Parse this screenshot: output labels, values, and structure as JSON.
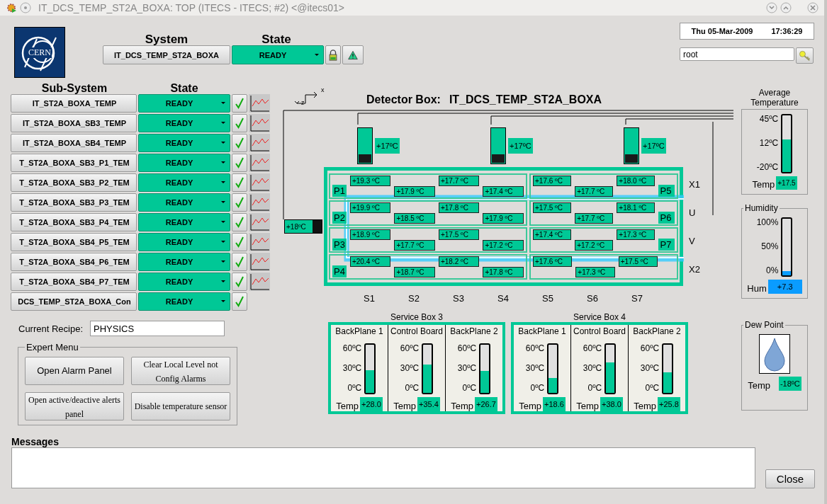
{
  "window": {
    "title": "IT_DCS_TEMP_ST2A_BOXA: TOP (ITECS - ITECS; #2) <@itecs01>"
  },
  "logo": {
    "text": "CERN"
  },
  "system": {
    "system_header": "System",
    "state_header": "State",
    "name": "IT_DCS_TEMP_ST2A_BOXA",
    "state": "READY"
  },
  "clock": {
    "date": "Thu 05-Mar-2009",
    "time": "17:36:29"
  },
  "user": {
    "value": "root"
  },
  "subsystems": {
    "name_header": "Sub-System",
    "state_header": "State",
    "rows": [
      {
        "name": "IT_ST2A_BOXA_TEMP",
        "state": "READY",
        "ok": true,
        "trend": true
      },
      {
        "name": "IT_ST2A_BOXA_SB3_TEMP",
        "state": "READY",
        "ok": true,
        "trend": true
      },
      {
        "name": "IT_ST2A_BOXA_SB4_TEMP",
        "state": "READY",
        "ok": true,
        "trend": true
      },
      {
        "name": "T_ST2A_BOXA_SB3_P1_TEM",
        "state": "READY",
        "ok": true,
        "trend": true
      },
      {
        "name": "T_ST2A_BOXA_SB3_P2_TEM",
        "state": "READY",
        "ok": true,
        "trend": true
      },
      {
        "name": "T_ST2A_BOXA_SB3_P3_TEM",
        "state": "READY",
        "ok": true,
        "trend": true
      },
      {
        "name": "T_ST2A_BOXA_SB3_P4_TEM",
        "state": "READY",
        "ok": true,
        "trend": true
      },
      {
        "name": "T_ST2A_BOXA_SB4_P5_TEM",
        "state": "READY",
        "ok": true,
        "trend": true
      },
      {
        "name": "T_ST2A_BOXA_SB4_P6_TEM",
        "state": "READY",
        "ok": true,
        "trend": true
      },
      {
        "name": "T_ST2A_BOXA_SB4_P7_TEM",
        "state": "READY",
        "ok": true,
        "trend": true
      },
      {
        "name": "DCS_TEMP_ST2A_BOXA_Con",
        "state": "READY",
        "ok": true,
        "trend": false
      }
    ]
  },
  "recipe": {
    "label": "Current Recipe:",
    "value": "PHYSICS"
  },
  "expert_menu": {
    "title": "Expert Menu",
    "buttons": [
      "Open Alarm Panel",
      "Clear Local Level not Config Alarms",
      "Open active/deactive alerts panel",
      "Disable temperature sensor"
    ]
  },
  "detector": {
    "axis_labels": [
      "x",
      "z"
    ],
    "title": "Detector Box:",
    "name": "IT_DCS_TEMP_ST2A_BOXA",
    "cooling_units": [
      {
        "reading": "+17ºC"
      },
      {
        "reading": "+17ºC"
      },
      {
        "reading": "+17ºC"
      }
    ],
    "side_unit": {
      "reading": "+18ºC"
    },
    "rows": [
      {
        "label": "X1",
        "left_tag": "P1",
        "left": [
          "+19.3 ºC",
          "+17.9 ºC",
          "+17.7 ºC",
          "+17.4 ºC"
        ],
        "right": [
          "+17.6 ºC",
          "+17.7 ºC",
          "+18.0 ºC"
        ],
        "right_tag": "P5"
      },
      {
        "label": "U",
        "left_tag": "P2",
        "left": [
          "+19.9 ºC",
          "+18.5 ºC",
          "+17.8 ºC",
          "+17.9 ºC"
        ],
        "right": [
          "+17.5 ºC",
          "+17.7 ºC",
          "+18.1 ºC"
        ],
        "right_tag": "P6"
      },
      {
        "label": "V",
        "left_tag": "P3",
        "left": [
          "+18.9 ºC",
          "+17.7 ºC",
          "+17.5 ºC",
          "+17.2 ºC"
        ],
        "right": [
          "+17.4 ºC",
          "+17.2 ºC",
          "+17.3 ºC"
        ],
        "right_tag": "P7"
      },
      {
        "label": "X2",
        "left_tag": "P4",
        "left": [
          "+20.4 ºC",
          "+18.7 ºC",
          "+18.2 ºC",
          "+17.8 ºC"
        ],
        "right": [
          "+17.6 ºC",
          "+17.3 ºC",
          "+17.5 ºC"
        ]
      }
    ],
    "columns": [
      "S1",
      "S2",
      "S3",
      "S4",
      "S5",
      "S6",
      "S7"
    ]
  },
  "service_boxes": [
    {
      "title": "Service Box 3",
      "panels": [
        {
          "title": "BackPlane 1",
          "ticks": [
            "60ºC",
            "30ºC",
            "0ºC"
          ],
          "level": 0.47,
          "label": "Temp",
          "reading": "+28.0"
        },
        {
          "title": "Control Board",
          "ticks": [
            "60ºC",
            "30ºC",
            "0ºC"
          ],
          "level": 0.59,
          "label": "Temp",
          "reading": "+35.4"
        },
        {
          "title": "BackPlane 2",
          "ticks": [
            "60ºC",
            "30ºC",
            "0ºC"
          ],
          "level": 0.45,
          "label": "Temp",
          "reading": "+26.7"
        }
      ]
    },
    {
      "title": "Service Box 4",
      "panels": [
        {
          "title": "BackPlane 1",
          "ticks": [
            "60ºC",
            "30ºC",
            "0ºC"
          ],
          "level": 0.31,
          "label": "Temp",
          "reading": "+18.6"
        },
        {
          "title": "Control Board",
          "ticks": [
            "60ºC",
            "30ºC",
            "0ºC"
          ],
          "level": 0.63,
          "label": "Temp",
          "reading": "+38.0"
        },
        {
          "title": "BackPlane 2",
          "ticks": [
            "60ºC",
            "30ºC",
            "0ºC"
          ],
          "level": 0.43,
          "label": "Temp",
          "reading": "+25.8"
        }
      ]
    }
  ],
  "average_temperature": {
    "title": "Average Temperature",
    "ticks": [
      "45ºC",
      "12ºC",
      "-20ºC"
    ],
    "level": 0.58,
    "label": "Temp",
    "reading": "+17.5"
  },
  "humidity": {
    "title": "Humidity",
    "ticks": [
      "100%",
      "50%",
      "0%"
    ],
    "level": 0.07,
    "label": "Hum",
    "reading": "+7.3"
  },
  "dew_point": {
    "title": "Dew Point",
    "label": "Temp",
    "reading": "-18ºC"
  },
  "messages": {
    "title": "Messages"
  },
  "close_button": "Close"
}
